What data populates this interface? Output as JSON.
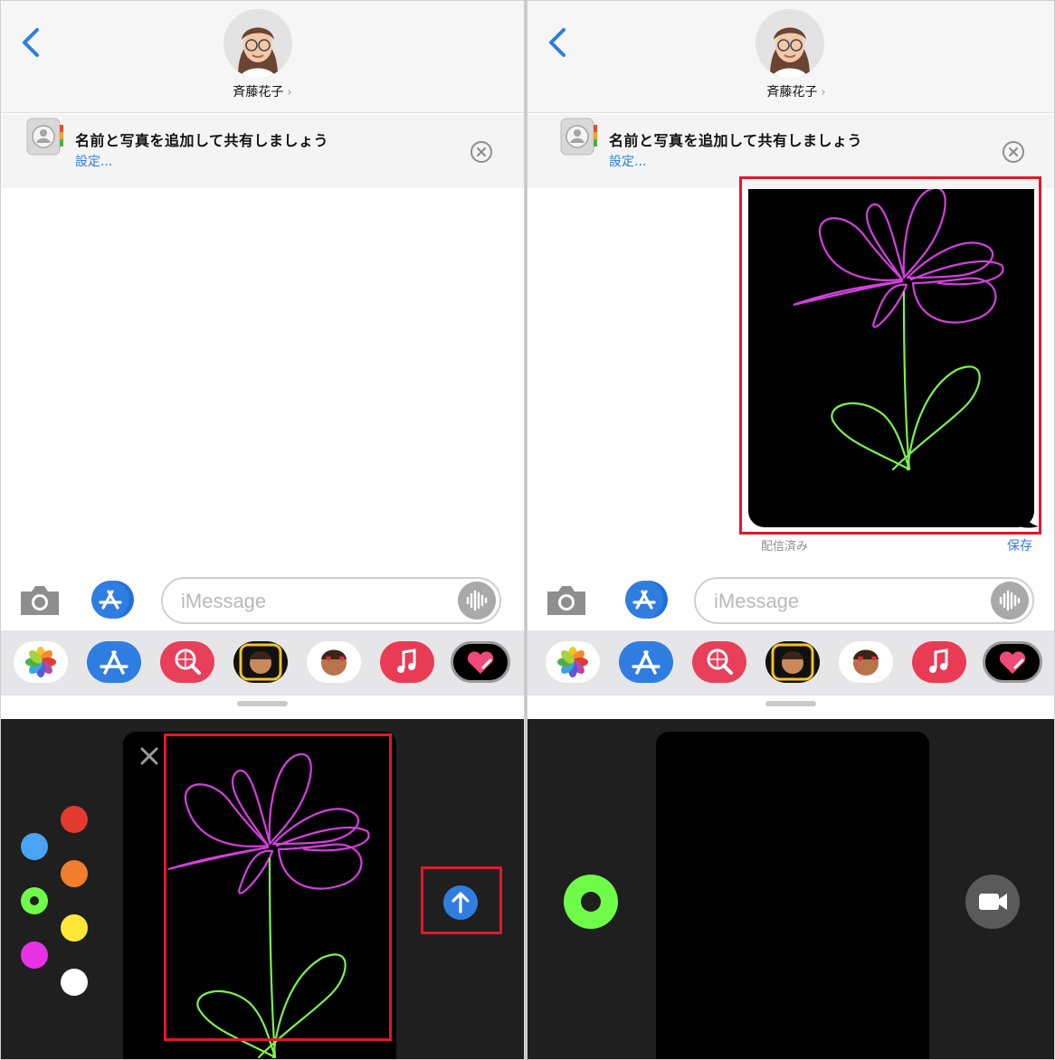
{
  "left": {
    "contact_name": "斉藤花子",
    "banner": {
      "title": "名前と写真を追加して共有しましょう",
      "link": "設定..."
    },
    "input_placeholder": "iMessage",
    "colors": [
      "#4aa3f5",
      "#e13a2e",
      "#f07e2c",
      "#6efc48",
      "#fde935",
      "#e732e6",
      "#ffffff"
    ]
  },
  "right": {
    "contact_name": "斉藤花子",
    "banner": {
      "title": "名前と写真を追加して共有しましょう",
      "link": "設定..."
    },
    "input_placeholder": "iMessage",
    "delivered": "配信済み",
    "save": "保存"
  },
  "apps": [
    "photos-app-icon",
    "appstore-app-icon",
    "search-images-app-icon",
    "memoji-app-icon",
    "memoji-stickers-app-icon",
    "music-app-icon",
    "digital-touch-app-icon"
  ]
}
